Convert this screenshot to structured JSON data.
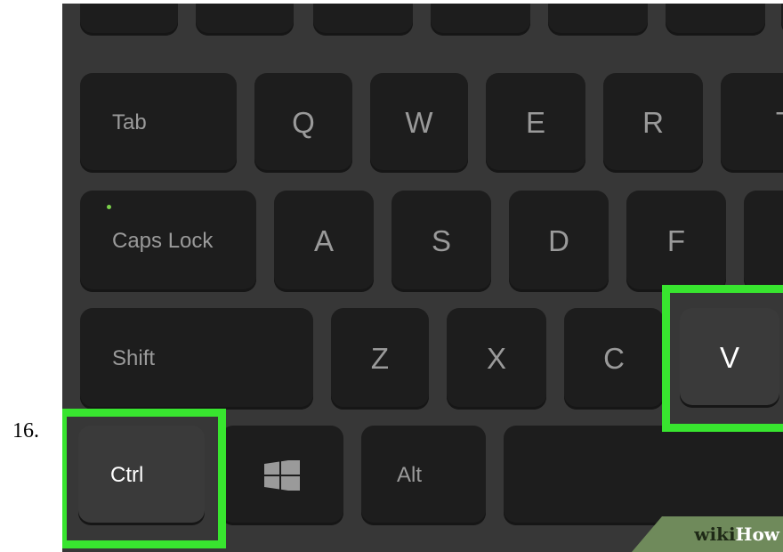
{
  "step": {
    "number": "16."
  },
  "keys": {
    "tab": "Tab",
    "q": "Q",
    "w": "W",
    "e": "E",
    "r": "R",
    "t": "T",
    "caps_lock": "Caps Lock",
    "a": "A",
    "s": "S",
    "d": "D",
    "f": "F",
    "shift": "Shift",
    "z": "Z",
    "x": "X",
    "c": "C",
    "v": "V",
    "ctrl": "Ctrl",
    "alt": "Alt"
  },
  "highlighted_keys": [
    "Ctrl",
    "V"
  ],
  "colors": {
    "highlight": "#38e52f",
    "board": "#373737",
    "key": "#1d1d1d",
    "caps_led": "#7ad14b"
  },
  "watermark": {
    "wiki": "wiki",
    "how": "How"
  }
}
